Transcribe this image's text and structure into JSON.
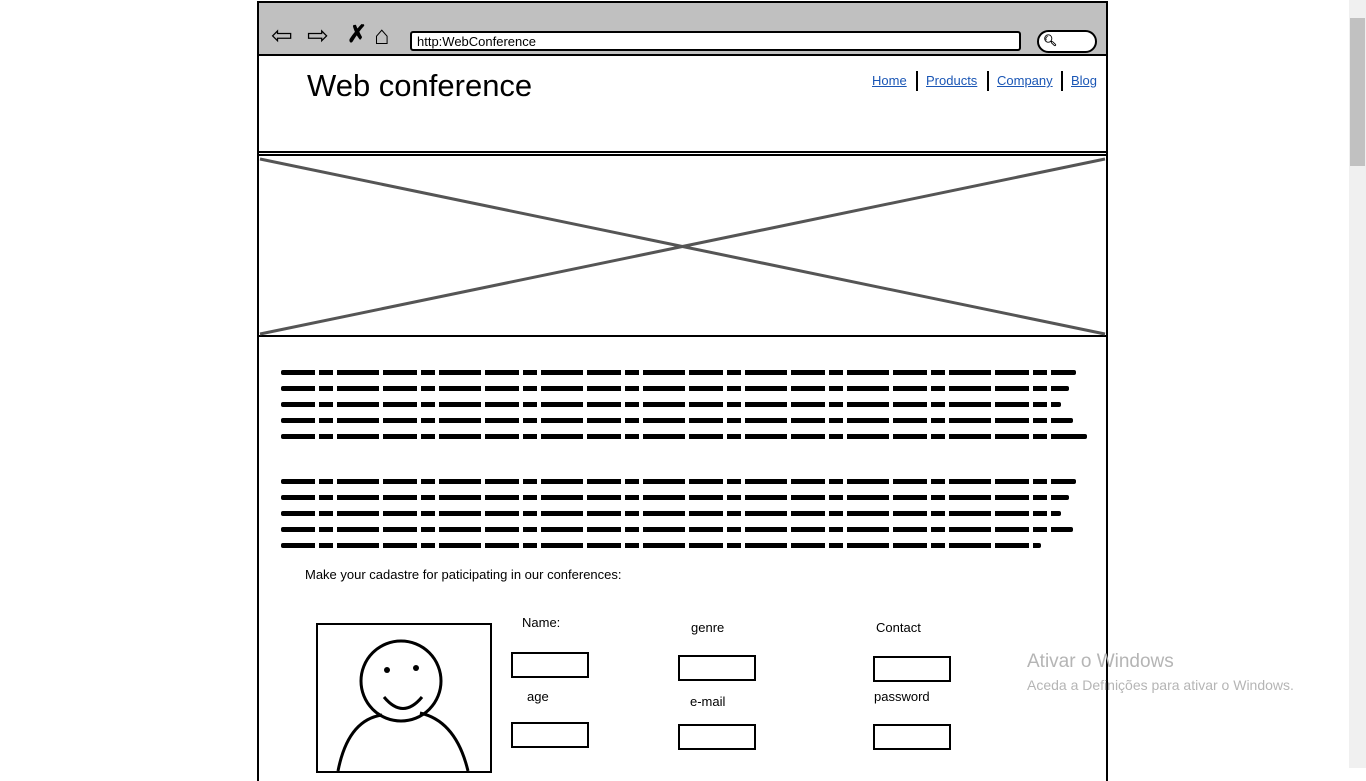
{
  "browser": {
    "url": "http:WebConference",
    "icons": [
      "back-arrow-icon",
      "forward-arrow-icon",
      "close-icon",
      "home-icon",
      "search-icon"
    ]
  },
  "header": {
    "title": "Web conference",
    "nav": [
      "Home",
      "Products",
      "Company",
      "Blog"
    ],
    "link_color": "#1a56b5"
  },
  "hero": {
    "type": "image-placeholder"
  },
  "form": {
    "intro": "Make your cadastre for paticipating in our conferences:",
    "fields": {
      "name": "Name:",
      "genre": "genre",
      "contact": "Contact",
      "age": "age",
      "email": "e-mail",
      "password": "password"
    }
  },
  "watermark": {
    "title": "Ativar o Windows",
    "subtitle": "Aceda a Definições para ativar o Windows."
  }
}
